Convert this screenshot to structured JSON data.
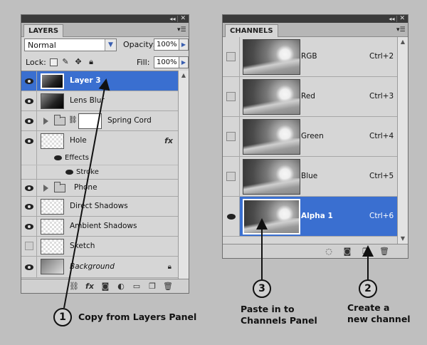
{
  "layers_panel": {
    "tab": "LAYERS",
    "blend_mode": "Normal",
    "opacity_label": "Opacity:",
    "opacity_value": "100%",
    "lock_label": "Lock:",
    "fill_label": "Fill:",
    "fill_value": "100%",
    "layers": [
      {
        "name": "Layer 3",
        "selected": true,
        "visible": true,
        "thumb": "dark"
      },
      {
        "name": "Lens Blur",
        "selected": false,
        "visible": true,
        "thumb": "dark"
      },
      {
        "name": "Spring Cord",
        "selected": false,
        "visible": true,
        "type": "group-masked"
      },
      {
        "name": "Hole",
        "selected": false,
        "visible": true,
        "thumb": "check",
        "fx": "fx"
      },
      {
        "name": "Effects",
        "type": "effects"
      },
      {
        "name": "Stroke",
        "type": "effect"
      },
      {
        "name": "Phone",
        "selected": false,
        "visible": true,
        "type": "group"
      },
      {
        "name": "Direct Shadows",
        "selected": false,
        "visible": true,
        "thumb": "check"
      },
      {
        "name": "Ambient Shadows",
        "selected": false,
        "visible": true,
        "thumb": "check"
      },
      {
        "name": "Sketch",
        "selected": false,
        "visible": false,
        "thumb": "check"
      },
      {
        "name": "Background",
        "selected": false,
        "visible": true,
        "thumb": "grad",
        "locked": true
      }
    ]
  },
  "channels_panel": {
    "tab": "CHANNELS",
    "channels": [
      {
        "name": "RGB",
        "shortcut": "Ctrl+2",
        "selected": false
      },
      {
        "name": "Red",
        "shortcut": "Ctrl+3",
        "selected": false
      },
      {
        "name": "Green",
        "shortcut": "Ctrl+4",
        "selected": false
      },
      {
        "name": "Blue",
        "shortcut": "Ctrl+5",
        "selected": false
      },
      {
        "name": "Alpha 1",
        "shortcut": "Ctrl+6",
        "selected": true
      }
    ]
  },
  "annotations": {
    "step1_number": "1",
    "step1_text": "Copy from Layers Panel",
    "step2_number": "2",
    "step2_line1": "Create a",
    "step2_line2": "new channel",
    "step3_number": "3",
    "step3_line1": "Paste in to",
    "step3_line2": "Channels Panel"
  },
  "icons": {
    "panel_menu": "menu-lines-icon",
    "eye": "eye-icon",
    "lock_transparent": "checkerboard-lock-icon",
    "lock_brush": "brush-icon",
    "lock_move": "move-icon",
    "lock_all": "padlock-icon",
    "link": "link-icon",
    "fx": "fx-icon",
    "mask": "mask-icon",
    "adjustment": "adjustment-icon",
    "folder": "folder-icon",
    "new_layer": "new-layer-icon",
    "trash": "trash-icon",
    "load_selection": "dotted-circle-icon",
    "save_selection": "mask-icon",
    "new_channel": "new-channel-icon"
  },
  "colors": {
    "selection": "#3a6fd0",
    "panel_bg": "#d6d6d6",
    "page_bg": "#bfbfbf"
  }
}
